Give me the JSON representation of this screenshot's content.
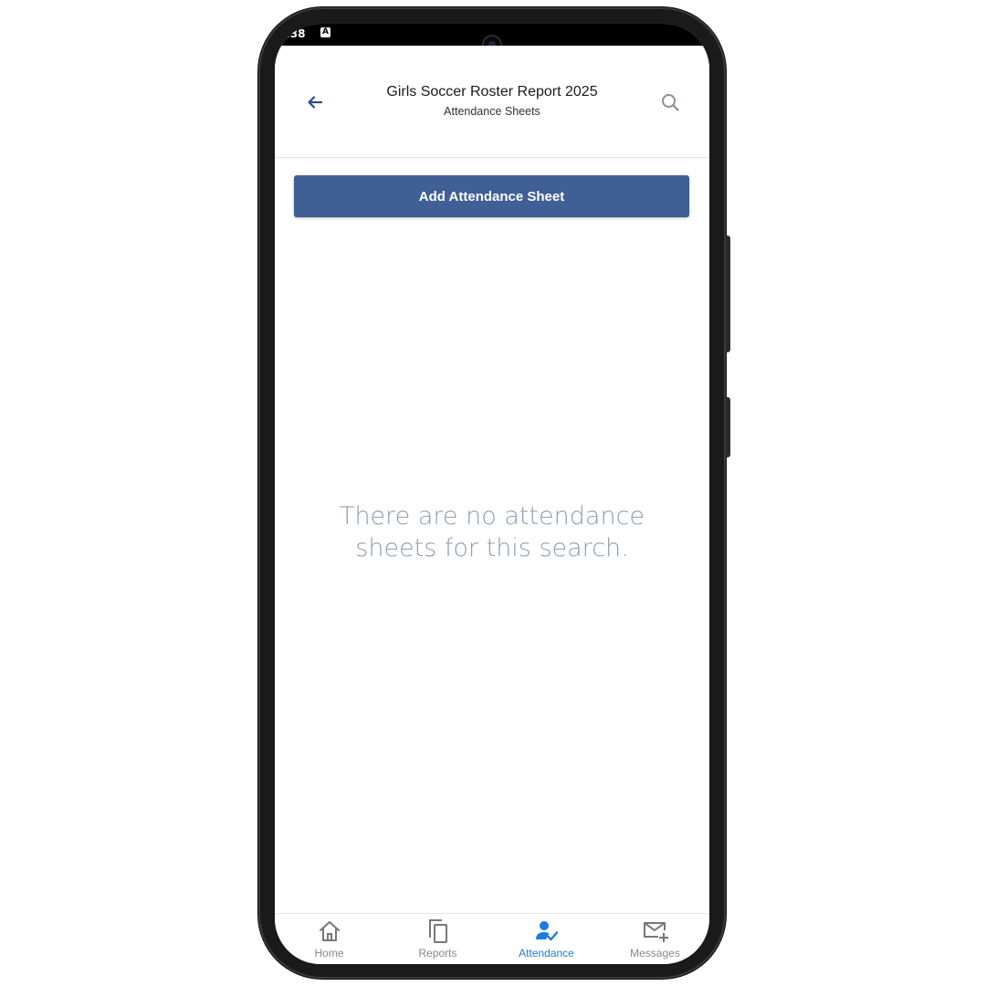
{
  "status": {
    "time": ":38",
    "indicator": "A"
  },
  "header": {
    "title": "Girls Soccer Roster Report 2025",
    "subtitle": "Attendance Sheets",
    "back_icon": "arrow-left-icon",
    "search_icon": "search-icon"
  },
  "main": {
    "add_button_label": "Add Attendance Sheet",
    "empty_message": "There are no attendance sheets for this search."
  },
  "tabs": [
    {
      "label": "Home",
      "icon": "home-icon"
    },
    {
      "label": "Reports",
      "icon": "copy-icon"
    },
    {
      "label": "Attendance",
      "icon": "person-check-icon",
      "active": true
    },
    {
      "label": "Messages",
      "icon": "mail-plus-icon"
    }
  ],
  "colors": {
    "accent": "#1e7be0",
    "button": "#3f5f95",
    "empty_text": "#8e9cb5",
    "back_arrow": "#2b4d87"
  }
}
